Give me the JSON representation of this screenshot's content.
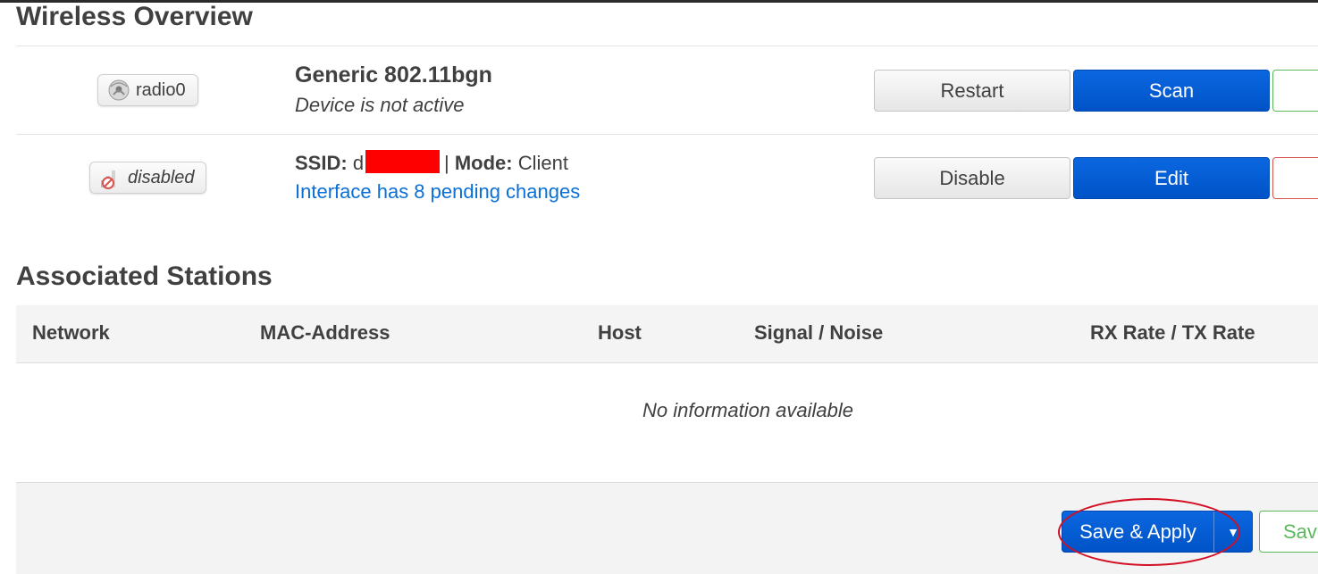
{
  "page_title": "Wireless Overview",
  "devices": [
    {
      "badge_label": "radio0",
      "badge_icon": "wifi-radio-icon",
      "title": "Generic 802.11bgn",
      "status": "Device is not active",
      "buttons": [
        "Restart",
        "Scan"
      ]
    }
  ],
  "networks": [
    {
      "badge_label": "disabled",
      "badge_icon": "wifi-disabled-icon",
      "ssid_label": "SSID:",
      "ssid_value": "d",
      "separator": "|",
      "mode_label": "Mode:",
      "mode_value": "Client",
      "pending": "Interface has 8 pending changes",
      "buttons": [
        "Disable",
        "Edit"
      ]
    }
  ],
  "stations": {
    "title": "Associated Stations",
    "columns": [
      "Network",
      "MAC-Address",
      "Host",
      "Signal / Noise",
      "RX Rate / TX Rate"
    ],
    "empty_message": "No information available"
  },
  "footer": {
    "save_apply": "Save & Apply",
    "save": "Save"
  },
  "colors": {
    "primary": "#0058d2",
    "link": "#0a6fd6",
    "success": "#5cb85c",
    "danger": "#d9534f",
    "annotation": "#d30f24"
  }
}
